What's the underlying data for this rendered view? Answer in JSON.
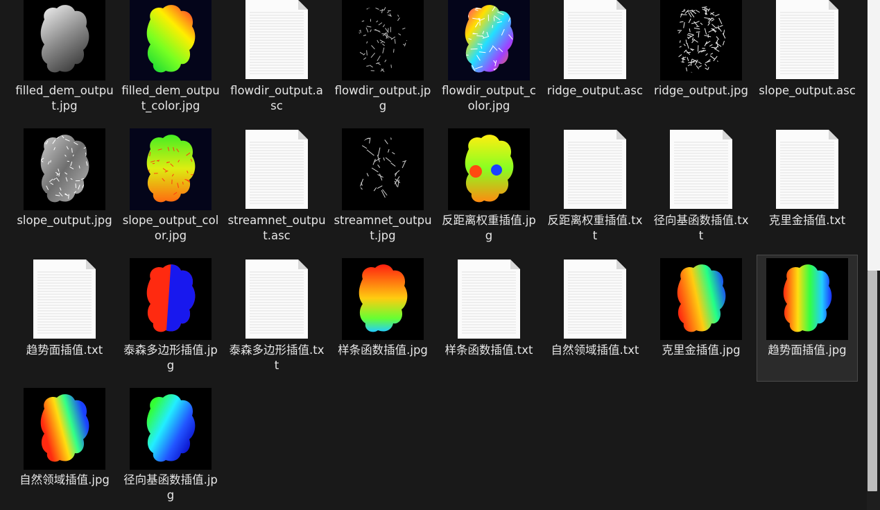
{
  "files": [
    {
      "name": "filled_dem_output.jpg",
      "kind": "image",
      "thumb": "gray-dem",
      "bg": "black"
    },
    {
      "name": "filled_dem_output_color.jpg",
      "kind": "image",
      "thumb": "color-dem",
      "bg": "navy"
    },
    {
      "name": "flowdir_output.asc",
      "kind": "document"
    },
    {
      "name": "flowdir_output.jpg",
      "kind": "image",
      "thumb": "sparse-gray",
      "bg": "black"
    },
    {
      "name": "flowdir_output_color.jpg",
      "kind": "image",
      "thumb": "psychedelic",
      "bg": "navy"
    },
    {
      "name": "ridge_output.asc",
      "kind": "document"
    },
    {
      "name": "ridge_output.jpg",
      "kind": "image",
      "thumb": "ridge-white",
      "bg": "black"
    },
    {
      "name": "slope_output.asc",
      "kind": "document"
    },
    {
      "name": "slope_output.jpg",
      "kind": "image",
      "thumb": "gray-slope",
      "bg": "black"
    },
    {
      "name": "slope_output_color.jpg",
      "kind": "image",
      "thumb": "color-slope",
      "bg": "navy"
    },
    {
      "name": "streamnet_output.asc",
      "kind": "document"
    },
    {
      "name": "streamnet_output.jpg",
      "kind": "image",
      "thumb": "streams",
      "bg": "black"
    },
    {
      "name": "反距离权重插值.jpg",
      "kind": "image",
      "thumb": "idw",
      "bg": "black"
    },
    {
      "name": "反距离权重插值.txt",
      "kind": "document"
    },
    {
      "name": "径向基函数插值.txt",
      "kind": "document"
    },
    {
      "name": "克里金插值.txt",
      "kind": "document"
    },
    {
      "name": "趋势面插值.txt",
      "kind": "document"
    },
    {
      "name": "泰森多边形插值.jpg",
      "kind": "image",
      "thumb": "thiessen",
      "bg": "black"
    },
    {
      "name": "泰森多边形插值.txt",
      "kind": "document"
    },
    {
      "name": "样条函数插值.jpg",
      "kind": "image",
      "thumb": "spline",
      "bg": "black"
    },
    {
      "name": "样条函数插值.txt",
      "kind": "document"
    },
    {
      "name": "自然领域插值.txt",
      "kind": "document"
    },
    {
      "name": "克里金插值.jpg",
      "kind": "image",
      "thumb": "kriging",
      "bg": "black"
    },
    {
      "name": "趋势面插值.jpg",
      "kind": "image",
      "thumb": "trend",
      "bg": "black",
      "selected": true
    },
    {
      "name": "自然领域插值.jpg",
      "kind": "image",
      "thumb": "natural",
      "bg": "black"
    },
    {
      "name": "径向基函数插值.jpg",
      "kind": "image",
      "thumb": "rbf",
      "bg": "black"
    }
  ],
  "colors": {
    "background": "#191919",
    "text": "#e6e6e6",
    "selection": "#2b2b2b"
  }
}
